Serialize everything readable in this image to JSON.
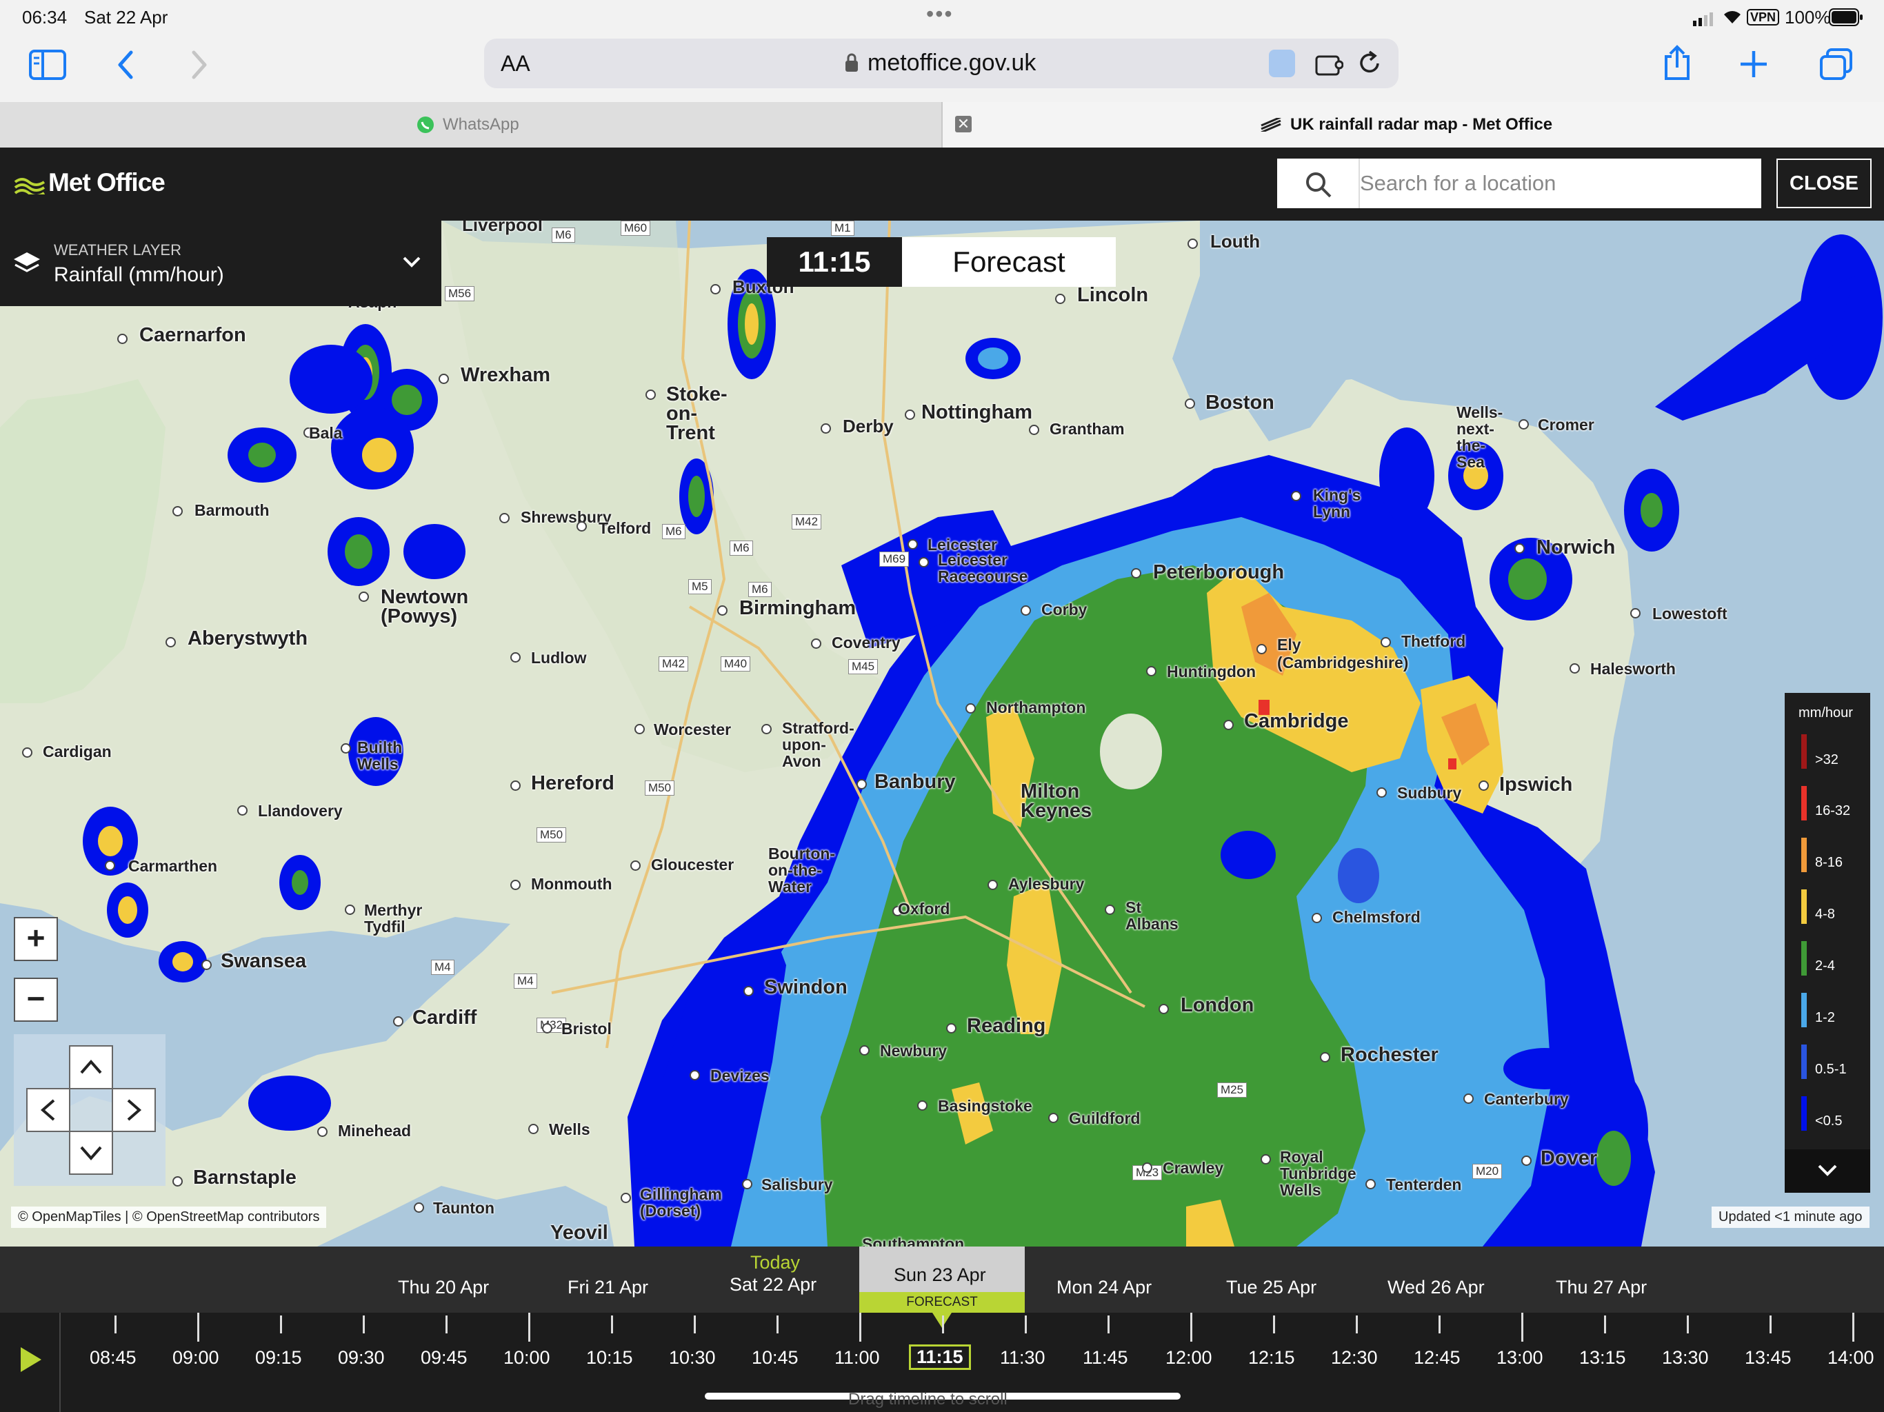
{
  "status_bar": {
    "time": "06:34",
    "date": "Sat 22 Apr",
    "vpn": "VPN",
    "battery": "100%",
    "dots": "•••"
  },
  "browser": {
    "aa_label": "AA",
    "url": "metoffice.gov.uk",
    "tabs": [
      {
        "label": "WhatsApp"
      },
      {
        "label": "UK rainfall radar map - Met Office"
      }
    ]
  },
  "header": {
    "logo": "Met Office",
    "search_placeholder": "Search for a location",
    "close_label": "CLOSE"
  },
  "weather_layer": {
    "caption": "WEATHER LAYER",
    "value": "Rainfall (mm/hour)"
  },
  "time_badge": {
    "time": "11:15",
    "mode": "Forecast"
  },
  "map": {
    "zoom_in": "+",
    "zoom_out": "−",
    "attribution": "© OpenMapTiles | © OpenStreetMap contributors",
    "updated": "Updated <1 minute ago",
    "places": [
      "Liverpool",
      "Louth",
      "Buxton",
      "Lincoln",
      "Asaph",
      "Caernarfon",
      "Wrexham",
      "Stoke-on-Trent",
      "Nottingham",
      "Derby",
      "Grantham",
      "Boston",
      "Bala",
      "Wells-next-the-Sea",
      "Cromer",
      "Barmouth",
      "Shrewsbury",
      "Telford",
      "King's Lynn",
      "Leicester",
      "Leicester Racecourse",
      "Peterborough",
      "Norwich",
      "Newtown (Powys)",
      "Birmingham",
      "Corby",
      "Thetford",
      "Lowestoft",
      "Aberystwyth",
      "Ludlow",
      "Coventry",
      "Ely (Cambridgeshire)",
      "Huntingdon",
      "Halesworth",
      "Northampton",
      "Cambridge",
      "Worcester",
      "Stratford-upon-Avon",
      "Cardigan",
      "Builth Wells",
      "Hereford",
      "Banbury",
      "Milton Keynes",
      "Sudbury",
      "Ipswich",
      "Llandovery",
      "Carmarthen",
      "Gloucester",
      "Bourton-on-the-Water",
      "Monmouth",
      "Aylesbury",
      "St Albans",
      "Merthyr Tydfil",
      "Oxford",
      "Chelmsford",
      "Swansea",
      "Swindon",
      "London",
      "Cardiff",
      "Bristol",
      "Reading",
      "Newbury",
      "Rochester",
      "Devizes",
      "Basingstoke",
      "Guildford",
      "Canterbury",
      "Minehead",
      "Wells",
      "Crawley",
      "Royal Tunbridge Wells",
      "Dover",
      "Barnstaple",
      "Salisbury",
      "Tenterden",
      "Gillingham (Dorset)",
      "Taunton",
      "Yeovil",
      "Southampton"
    ],
    "roads": [
      "M6",
      "M60",
      "M1",
      "M56",
      "M6",
      "M42",
      "M6",
      "M69",
      "M5",
      "M6",
      "M42",
      "M40",
      "M45",
      "M50",
      "M50",
      "M4",
      "M4",
      "M32",
      "M25",
      "M23",
      "M20"
    ]
  },
  "legend": {
    "title": "mm/hour",
    "items": [
      {
        "label": ">32",
        "color": "#a01818"
      },
      {
        "label": "16-32",
        "color": "#e8322a"
      },
      {
        "label": "8-16",
        "color": "#f09a3a"
      },
      {
        "label": "4-8",
        "color": "#f3cb3f"
      },
      {
        "label": "2-4",
        "color": "#3f9a36"
      },
      {
        "label": "1-2",
        "color": "#4aa8e8"
      },
      {
        "label": "0.5-1",
        "color": "#2a55e0"
      },
      {
        "label": "<0.5",
        "color": "#0010ea"
      }
    ]
  },
  "timeline": {
    "days": [
      {
        "label": "Thu 20 Apr"
      },
      {
        "label": "Fri 21 Apr"
      },
      {
        "today": "Today",
        "label": "Sat 22 Apr"
      },
      {
        "label": "Sun 23 Apr",
        "badge": "FORECAST"
      },
      {
        "label": "Mon 24 Apr"
      },
      {
        "label": "Tue 25 Apr"
      },
      {
        "label": "Wed 26 Apr"
      },
      {
        "label": "Thu 27 Apr"
      }
    ],
    "times": [
      "08:45",
      "09:00",
      "09:15",
      "09:30",
      "09:45",
      "10:00",
      "10:15",
      "10:30",
      "10:45",
      "11:00",
      "11:15",
      "11:30",
      "11:45",
      "12:00",
      "12:15",
      "12:30",
      "12:45",
      "13:00",
      "13:15",
      "13:30",
      "13:45",
      "14:00"
    ],
    "selected": "11:15",
    "hint": "Drag timeline to scroll"
  },
  "colors": {
    "accent": "#b9d534",
    "rain_light": "#0010ea"
  }
}
